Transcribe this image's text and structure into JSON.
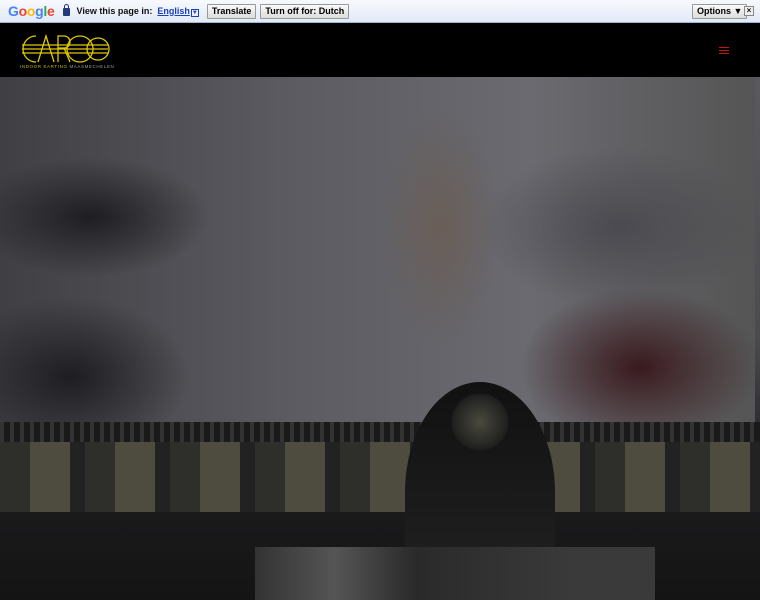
{
  "translate_bar": {
    "brand": "Google",
    "prompt": "View this page in:",
    "language": "English",
    "translate_label": "Translate",
    "turn_off_label": "Turn off for: Dutch",
    "options_label": "Options ▼",
    "close_label": "×"
  },
  "header": {
    "logo_text": "CARGO",
    "tagline_a": "INDOOR KARTING",
    "tagline_b": "MAASMECHELEN",
    "menu_icon": "hamburger-icon",
    "menu_color": "#d01010"
  }
}
